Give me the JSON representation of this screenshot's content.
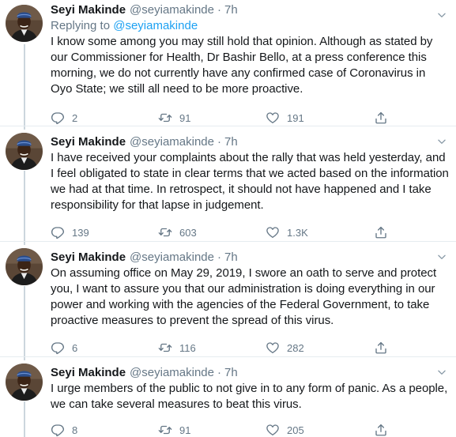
{
  "colors": {
    "text": "#14171a",
    "secondary": "#657786",
    "link": "#1da1f2",
    "divider": "#e6ecf0",
    "thread_line": "#ccd6dd"
  },
  "icons": {
    "reply": "comment-bubble-icon",
    "retweet": "retweet-arrows-icon",
    "like": "heart-outline-icon",
    "share": "share-upload-icon",
    "menu": "chevron-down-icon"
  },
  "tweets": [
    {
      "name": "Seyi Makinde",
      "handle": "@seyiamakinde",
      "dot": "·",
      "time": "7h",
      "reply_prefix": "Replying to",
      "reply_handle": "@seyiamakinde",
      "text": "I know some among you may still hold that opinion. Although as stated by our Commissioner for Health, Dr Bashir Bello, at a press conference this morning, we do not currently have any confirmed case of Coronavirus in Oyo State; we still all need to be more proactive.",
      "replies": "2",
      "retweets": "91",
      "likes": "191"
    },
    {
      "name": "Seyi Makinde",
      "handle": "@seyiamakinde",
      "dot": "·",
      "time": "7h",
      "text": "I have received your complaints about the rally that was held yesterday, and I feel obligated to state in clear terms that we acted based on the information we had at that time. In retrospect, it should not have happened and I take responsibility for that lapse in judgement.",
      "replies": "139",
      "retweets": "603",
      "likes": "1.3K"
    },
    {
      "name": "Seyi Makinde",
      "handle": "@seyiamakinde",
      "dot": "·",
      "time": "7h",
      "text": "On assuming office on May 29, 2019, I swore an oath to serve and protect you, I want to assure you that our administration is doing everything in our power and working with the agencies of the Federal Government, to take proactive measures to prevent the spread of this virus.",
      "replies": "6",
      "retweets": "116",
      "likes": "282"
    },
    {
      "name": "Seyi Makinde",
      "handle": "@seyiamakinde",
      "dot": "·",
      "time": "7h",
      "text": "I urge members of the public to not give in to any form of panic. As a people, we can take several measures to beat this virus.",
      "replies": "8",
      "retweets": "91",
      "likes": "205"
    }
  ]
}
